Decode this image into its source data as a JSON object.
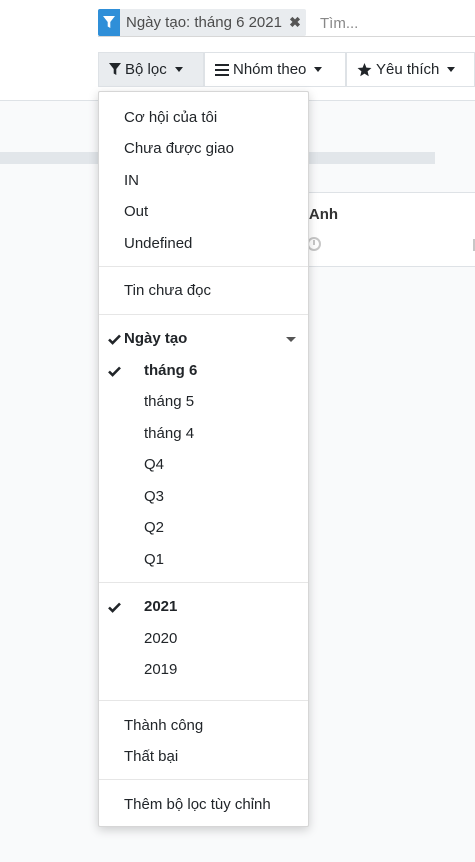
{
  "search": {
    "facet_label": "Ngày tạo: tháng 6 2021",
    "facet_icon": "filter-icon",
    "facet_close_icon": "close-icon",
    "placeholder": "Tìm..."
  },
  "toolbar": {
    "filters_label": "Bộ lọc",
    "group_by_label": "Nhóm theo",
    "favorites_label": "Yêu thích"
  },
  "kanban": {
    "card_title": "ng Anh"
  },
  "filters_menu": {
    "group1": [
      "Cơ hội của tôi",
      "Chưa được giao",
      "IN",
      "Out",
      "Undefined"
    ],
    "group2": [
      "Tin chưa đọc"
    ],
    "date_header": "Ngày tạo",
    "periods": [
      "tháng 6",
      "tháng 5",
      "tháng 4",
      "Q4",
      "Q3",
      "Q2",
      "Q1"
    ],
    "years": [
      "2021",
      "2020",
      "2019"
    ],
    "group4": [
      "Thành công",
      "Thất bại"
    ],
    "custom": "Thêm bộ lọc tùy chỉnh"
  },
  "colors": {
    "facet_accent": "#2f8fd8",
    "active_button_bg": "#e9ecef"
  }
}
